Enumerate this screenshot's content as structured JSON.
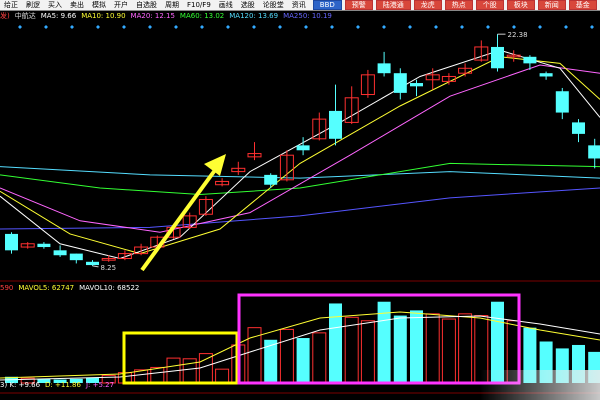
{
  "toolbar": {
    "items": [
      "给正",
      "刷逻",
      "买入",
      "卖出",
      "模拟",
      "开户",
      "自选股",
      "周期",
      "F10/F9",
      "画线",
      "选股",
      "论股堂",
      "资讯"
    ],
    "buttons": [
      {
        "label": "BBD",
        "style": "blue"
      },
      {
        "label": "预警",
        "style": "red"
      },
      {
        "label": "陆港通",
        "style": "red"
      },
      {
        "label": "龙虎",
        "style": "red"
      },
      {
        "label": "热点",
        "style": "red"
      },
      {
        "label": "个股",
        "style": "red"
      },
      {
        "label": "板块",
        "style": "red"
      },
      {
        "label": "新闻",
        "style": "red"
      },
      {
        "label": "基金",
        "style": "red"
      },
      {
        "label": "外",
        "style": "red"
      }
    ]
  },
  "ma_legend": [
    {
      "text": "发)",
      "color": "#ff4040"
    },
    {
      "text": "中航达",
      "color": "#dddddd"
    },
    {
      "text": "MA5: 9.66",
      "color": "#ffffff"
    },
    {
      "text": "MA10: 10.90",
      "color": "#ffff33"
    },
    {
      "text": "MA20: 12.15",
      "color": "#ff66ff"
    },
    {
      "text": "MA60: 13.02",
      "color": "#33ff33"
    },
    {
      "text": "MA120: 13.69",
      "color": "#55ddff"
    },
    {
      "text": "MA250: 10.19",
      "color": "#6666ff"
    }
  ],
  "vol_legend": [
    {
      "text": "590",
      "color": "#ff4040"
    },
    {
      "text": "MAVOL5: 62747",
      "color": "#ffff33"
    },
    {
      "text": "MAVOL10: 68522",
      "color": "#ffffff"
    }
  ],
  "kdj_legend": [
    {
      "text": "3) K: +9.66",
      "color": "#ffffff"
    },
    {
      "text": "D: +11.86",
      "color": "#ffff33"
    },
    {
      "text": "J: +5.27",
      "color": "#ff66ff"
    }
  ],
  "annotations": {
    "high_label": "22.38",
    "low_label": "8.25"
  },
  "colors": {
    "up": "#ff3030",
    "down": "#55ffff",
    "arrow": "#ffff33",
    "box_yellow": "#ffff00",
    "box_magenta": "#ff33ff",
    "ma5": "#ffffff",
    "ma10": "#ffff33",
    "ma20": "#ff66ff",
    "ma60": "#33ff33",
    "ma120": "#55ddff",
    "ma250": "#5555ff"
  },
  "chart_data": {
    "type": "candlestick",
    "candles": [
      {
        "o": 10.2,
        "c": 9.2,
        "h": 10.3,
        "l": 9.0
      },
      {
        "o": 9.4,
        "c": 9.6,
        "h": 9.7,
        "l": 9.3
      },
      {
        "o": 9.6,
        "c": 9.4,
        "h": 9.7,
        "l": 9.3
      },
      {
        "o": 9.2,
        "c": 8.9,
        "h": 9.5,
        "l": 8.8
      },
      {
        "o": 9.0,
        "c": 8.6,
        "h": 9.0,
        "l": 8.4
      },
      {
        "o": 8.5,
        "c": 8.3,
        "h": 8.6,
        "l": 8.25
      },
      {
        "o": 8.6,
        "c": 8.7,
        "h": 8.9,
        "l": 8.5
      },
      {
        "o": 8.7,
        "c": 9.0,
        "h": 9.2,
        "l": 8.6
      },
      {
        "o": 9.0,
        "c": 9.4,
        "h": 9.6,
        "l": 8.9
      },
      {
        "o": 9.4,
        "c": 10.0,
        "h": 10.1,
        "l": 9.3
      },
      {
        "o": 10.0,
        "c": 10.6,
        "h": 10.8,
        "l": 9.9
      },
      {
        "o": 10.6,
        "c": 11.3,
        "h": 11.5,
        "l": 10.5
      },
      {
        "o": 11.4,
        "c": 12.3,
        "h": 12.5,
        "l": 11.3
      },
      {
        "o": 13.2,
        "c": 13.4,
        "h": 13.6,
        "l": 13.1
      },
      {
        "o": 14.0,
        "c": 14.2,
        "h": 14.6,
        "l": 13.8
      },
      {
        "o": 14.9,
        "c": 15.1,
        "h": 15.8,
        "l": 14.7
      },
      {
        "o": 13.8,
        "c": 13.2,
        "h": 13.9,
        "l": 13.0
      },
      {
        "o": 13.5,
        "c": 15.0,
        "h": 15.3,
        "l": 13.4
      },
      {
        "o": 15.6,
        "c": 15.3,
        "h": 16.1,
        "l": 15.0
      },
      {
        "o": 16.0,
        "c": 17.2,
        "h": 17.6,
        "l": 15.9
      },
      {
        "o": 17.7,
        "c": 16.0,
        "h": 19.3,
        "l": 15.6
      },
      {
        "o": 17.0,
        "c": 18.5,
        "h": 19.2,
        "l": 16.9
      },
      {
        "o": 18.7,
        "c": 19.9,
        "h": 20.2,
        "l": 18.5
      },
      {
        "o": 20.6,
        "c": 20.0,
        "h": 21.3,
        "l": 19.8
      },
      {
        "o": 20.0,
        "c": 18.8,
        "h": 20.3,
        "l": 18.4
      },
      {
        "o": 19.4,
        "c": 19.2,
        "h": 19.6,
        "l": 18.6
      },
      {
        "o": 19.6,
        "c": 19.9,
        "h": 20.3,
        "l": 19.0
      },
      {
        "o": 19.5,
        "c": 19.8,
        "h": 20.0,
        "l": 19.3
      },
      {
        "o": 20.0,
        "c": 20.3,
        "h": 20.6,
        "l": 19.8
      },
      {
        "o": 20.8,
        "c": 21.6,
        "h": 22.0,
        "l": 20.7
      },
      {
        "o": 21.6,
        "c": 20.3,
        "h": 22.38,
        "l": 20.1
      },
      {
        "o": 21.0,
        "c": 21.1,
        "h": 21.4,
        "l": 20.7
      },
      {
        "o": 21.0,
        "c": 20.6,
        "h": 21.1,
        "l": 20.2
      },
      {
        "o": 20.0,
        "c": 19.8,
        "h": 20.1,
        "l": 19.6
      },
      {
        "o": 18.9,
        "c": 17.6,
        "h": 19.1,
        "l": 17.2
      },
      {
        "o": 17.0,
        "c": 16.3,
        "h": 17.2,
        "l": 15.8
      },
      {
        "o": 15.6,
        "c": 14.8,
        "h": 16.0,
        "l": 14.2
      }
    ],
    "volume": [
      0.18,
      0.14,
      0.12,
      0.1,
      0.12,
      0.16,
      0.22,
      0.3,
      0.38,
      0.45,
      0.72,
      0.7,
      0.85,
      0.4,
      1.1,
      1.6,
      1.25,
      1.55,
      1.3,
      1.45,
      2.3,
      1.9,
      1.8,
      2.35,
      1.95,
      2.1,
      2.0,
      1.85,
      2.0,
      1.95,
      2.35,
      1.8,
      1.6,
      1.2,
      1.0,
      1.1,
      0.9
    ],
    "ylim": [
      8.0,
      23.0
    ],
    "high_label_index": 30,
    "low_label_index": 5
  }
}
